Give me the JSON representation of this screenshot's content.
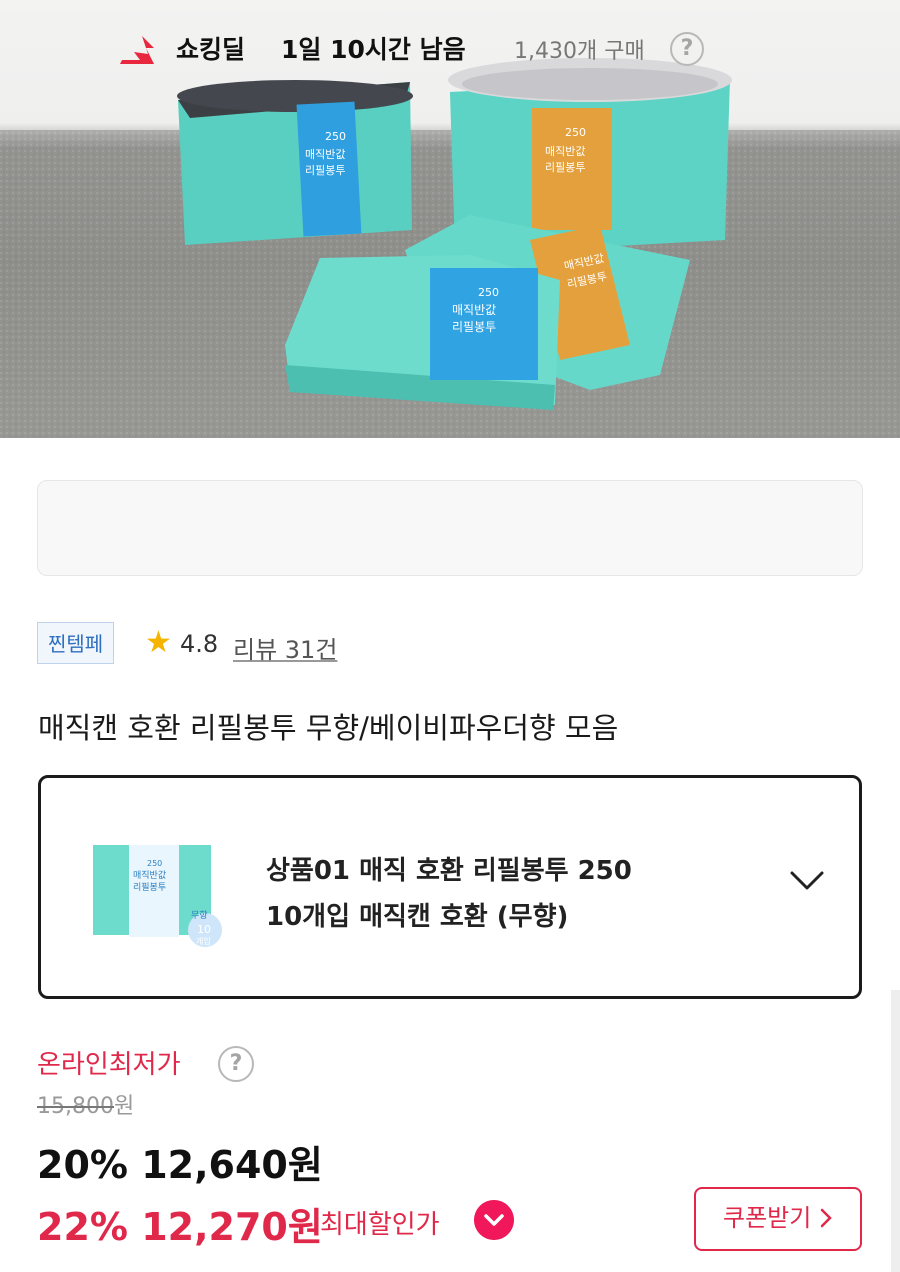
{
  "hero": {
    "pack_number": "250",
    "pack_line1": "매직반값",
    "pack_line2": "리필봉투",
    "colors": {
      "teal": "#5fd2c4",
      "blue_label": "#2fa0e0",
      "orange_label": "#e6a23c"
    }
  },
  "deal": {
    "icon": "lightning-deal-icon",
    "name": "쇼킹딜",
    "time_left": "1일 10시간 남음",
    "purchase_count": "1,430개 구매",
    "help_symbol": "?"
  },
  "tag": "찐템페",
  "rating": {
    "star": "★",
    "value": "4.8",
    "review_link": "리뷰 31건"
  },
  "product_title": "매직캔 호환 리필봉투 무향/베이비파우더향 모음",
  "option": {
    "line1": "상품01 매직 호환 리필봉투 250",
    "line2": "10개입 매직캔 호환 (무향)",
    "thumb_badge_top": "무향",
    "thumb_badge_num": "10",
    "thumb_badge_unit": "개입",
    "thumb_pack_number": "250",
    "thumb_pack_line1": "매직반값",
    "thumb_pack_line2": "리필봉투"
  },
  "price": {
    "lowest_label": "온라인최저가",
    "help_symbol": "?",
    "original": "15,800",
    "original_unit": "원",
    "sale_percent": "20%",
    "sale_price": "12,640",
    "sale_unit": "원",
    "max_percent": "22%",
    "max_price": "12,270",
    "max_unit": "원",
    "max_label": "최대할인가",
    "coupon_button": "쿠폰받기",
    "accent_color": "#e0284a"
  }
}
